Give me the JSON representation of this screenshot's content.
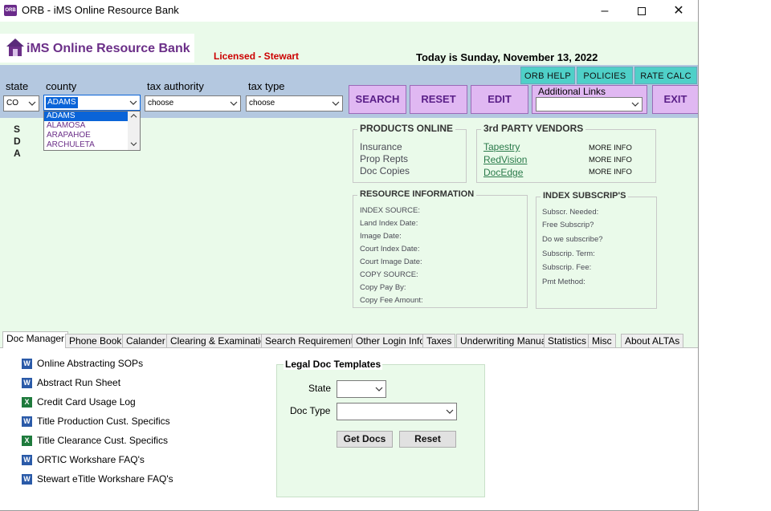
{
  "window": {
    "title": "ORB - iMS Online Resource Bank",
    "app_icon_text": "ORB"
  },
  "header": {
    "logo_text": "iMS Online Resource Bank",
    "licensed": "Licensed - Stewart",
    "today": "Today is Sunday, November 13, 2022"
  },
  "toolbar_links": {
    "orb_help": "ORB HELP",
    "policies": "POLICIES",
    "rate_calc": "RATE CALC"
  },
  "filters": {
    "state_label": "state",
    "state_value": "CO",
    "county_label": "county",
    "county_value": "ADAMS",
    "tax_authority_label": "tax authority",
    "tax_authority_value": "choose",
    "tax_type_label": "tax type",
    "tax_type_value": "choose"
  },
  "county_options": [
    "ADAMS",
    "ALAMOSA",
    "ARAPAHOE",
    "ARCHULETA"
  ],
  "actions": {
    "search": "SEARCH",
    "reset": "RESET",
    "edit": "EDIT",
    "exit": "EXIT",
    "additional_links": "Additional Links"
  },
  "side_letters": [
    "S",
    "D",
    "A"
  ],
  "products_online": {
    "title": "PRODUCTS ONLINE",
    "items": [
      "Insurance",
      "Prop Repts",
      "Doc Copies"
    ]
  },
  "vendors": {
    "title": "3rd PARTY VENDORS",
    "items": [
      {
        "name": "Tapestry",
        "more": "MORE INFO"
      },
      {
        "name": "RedVision",
        "more": "MORE INFO"
      },
      {
        "name": "DocEdge",
        "more": "MORE INFO"
      }
    ]
  },
  "resource_info": {
    "title": "RESOURCE INFORMATION",
    "items": [
      "INDEX SOURCE:",
      "Land Index Date:",
      "Image Date:",
      "Court Index Date:",
      "Court Image Date:",
      "COPY SOURCE:",
      "Copy Pay By:",
      "Copy Fee Amount:"
    ]
  },
  "index_subscrip": {
    "title": "INDEX SUBSCRIP'S",
    "items": [
      "Subscr. Needed:",
      "Free Subscrip?",
      "Do we subscribe?",
      "Subscrip. Term:",
      "Subscrip. Fee:",
      "Pmt Method:"
    ]
  },
  "tabs": [
    "Doc Manager",
    "Phone Book",
    "Calander",
    "Clearing & Examination",
    "Search Requirements",
    "Other Login Info",
    "Taxes",
    "Underwriting Manual",
    "Statistics",
    "Misc",
    "About ALTAs"
  ],
  "documents": [
    {
      "label": "Online Abstracting SOPs",
      "icon": "W"
    },
    {
      "label": "Abstract Run Sheet",
      "icon": "W"
    },
    {
      "label": "Credit Card Usage Log",
      "icon": "X"
    },
    {
      "label": "Title Production Cust. Specifics",
      "icon": "W"
    },
    {
      "label": "Title Clearance Cust. Specifics",
      "icon": "X"
    },
    {
      "label": "ORTIC Workshare FAQ's",
      "icon": "W"
    },
    {
      "label": "Stewart eTitle Workshare FAQ's",
      "icon": "W"
    }
  ],
  "legal_templates": {
    "title": "Legal Doc Templates",
    "state_label": "State",
    "doc_type_label": "Doc Type",
    "get_docs": "Get Docs",
    "reset": "Reset"
  }
}
